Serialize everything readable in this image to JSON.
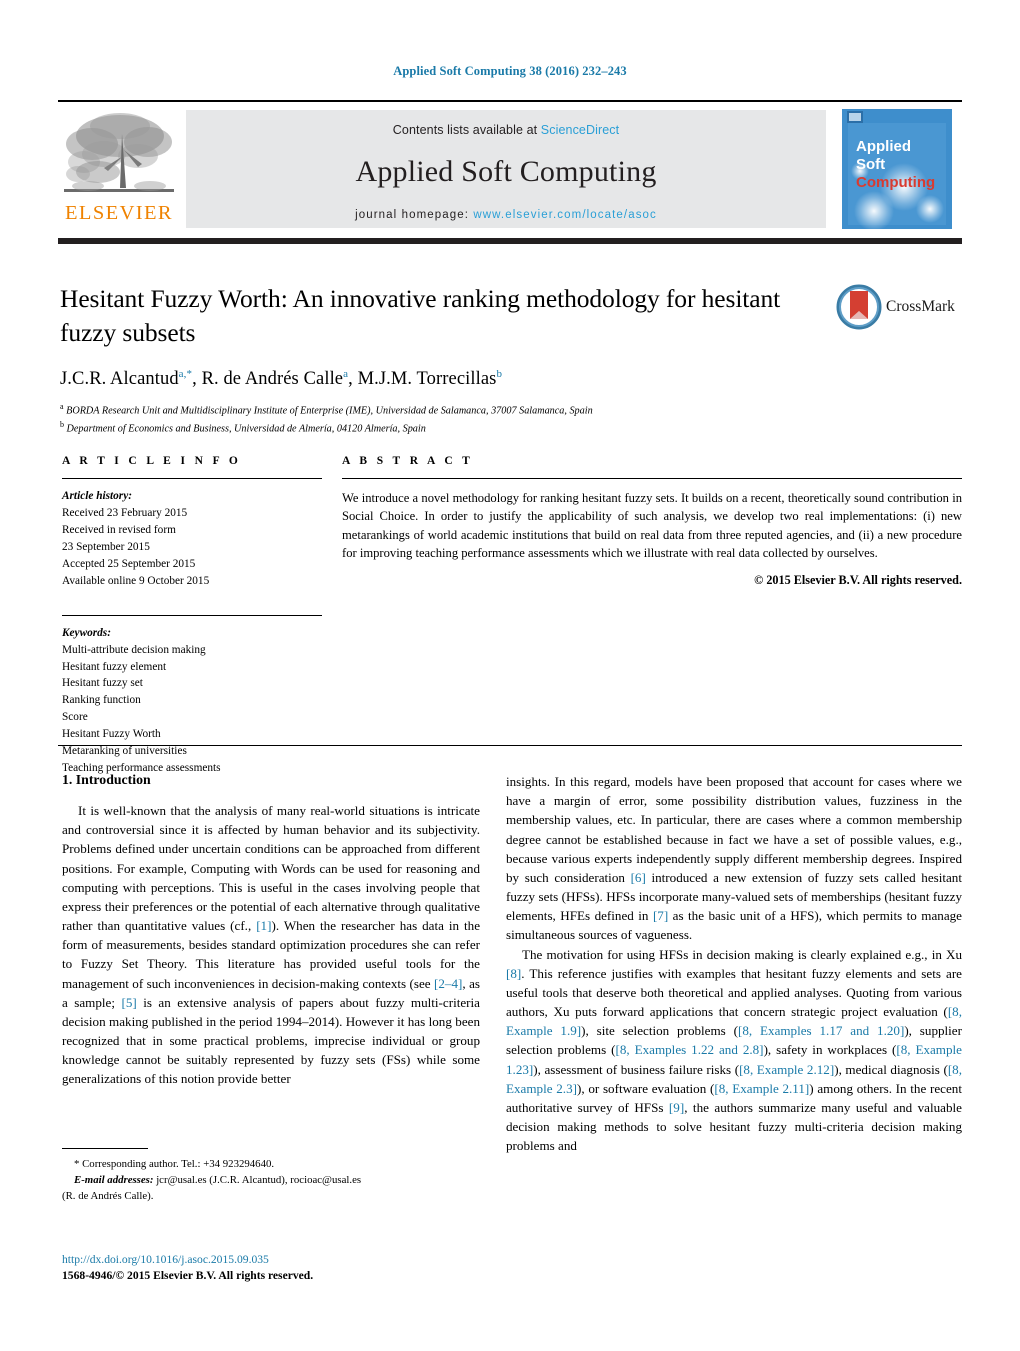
{
  "running_head": "Applied Soft Computing 38 (2016) 232–243",
  "masthead": {
    "contents_prefix": "Contents lists available at ",
    "sciencedirect": "ScienceDirect",
    "journal_title": "Applied Soft Computing",
    "homepage_prefix": "journal homepage: ",
    "homepage_url": "www.elsevier.com/locate/asoc",
    "publisher_wordmark": "ELSEVIER",
    "publisher_wordmark_color": "#ef8200",
    "cover": {
      "line1": "Applied",
      "line2": "Soft",
      "line3": "Computing",
      "bg_color": "#3e8ecc",
      "line3_color": "#d93b30"
    }
  },
  "crossmark": {
    "label": "CrossMark"
  },
  "article": {
    "title": "Hesitant Fuzzy Worth: An innovative ranking methodology for hesitant fuzzy subsets",
    "authors": [
      {
        "name": "J.C.R. Alcantud",
        "sup": "a,*"
      },
      {
        "name": "R. de Andrés Calle",
        "sup": "a"
      },
      {
        "name": "M.J.M. Torrecillas",
        "sup": "b"
      }
    ],
    "affiliations": [
      {
        "marker": "a",
        "text": "BORDA Research Unit and Multidisciplinary Institute of Enterprise (IME), Universidad de Salamanca, 37007 Salamanca, Spain"
      },
      {
        "marker": "b",
        "text": "Department of Economics and Business, Universidad de Almería, 04120 Almería, Spain"
      }
    ]
  },
  "article_info": {
    "heading": "A R T I C L E   I N F O",
    "history_label": "Article history:",
    "history_lines": [
      "Received 23 February 2015",
      "Received in revised form",
      "23 September 2015",
      "Accepted 25 September 2015",
      "Available online 9 October 2015"
    ],
    "keywords_label": "Keywords:",
    "keywords": [
      "Multi-attribute decision making",
      "Hesitant fuzzy element",
      "Hesitant fuzzy set",
      "Ranking function",
      "Score",
      "Hesitant Fuzzy Worth",
      "Metaranking of universities",
      "Teaching performance assessments"
    ]
  },
  "abstract": {
    "heading": "A B S T R A C T",
    "text": "We introduce a novel methodology for ranking hesitant fuzzy sets. It builds on a recent, theoretically sound contribution in Social Choice. In order to justify the applicability of such analysis, we develop two real implementations: (i) new metarankings of world academic institutions that build on real data from three reputed agencies, and (ii) a new procedure for improving teaching performance assessments which we illustrate with real data collected by ourselves.",
    "copyright": "© 2015 Elsevier B.V. All rights reserved."
  },
  "body": {
    "section_number_title": "1.  Introduction",
    "left_paragraph_1_a": "It is well-known that the analysis of many real-world situations is intricate and controversial since it is affected by human behavior and its subjectivity. Problems defined under uncertain conditions can be approached from different positions. For example, Computing with Words can be used for reasoning and computing with perceptions. This is useful in the cases involving people that express their preferences or the potential of each alternative through qualitative rather than quantitative values (cf., ",
    "ref_1": "[1]",
    "left_paragraph_1_b": "). When the researcher has data in the form of measurements, besides standard optimization procedures she can refer to Fuzzy Set Theory. This literature has provided useful tools for the management of such inconveniences in decision-making contexts (see ",
    "ref_2_4": "[2–4]",
    "left_paragraph_1_c": ", as a sample; ",
    "ref_5": "[5]",
    "left_paragraph_1_d": " is an extensive analysis of papers about fuzzy multi-criteria decision making published in the period 1994–2014). However it has long been recognized that in some practical problems, imprecise individual or group knowledge cannot be suitably represented by fuzzy sets (FSs) while some generalizations of this notion provide better",
    "right_paragraph_1_a": "insights. In this regard, models have been proposed that account for cases where we have a margin of error, some possibility distribution values, fuzziness in the membership values, etc. In particular, there are cases where a common membership degree cannot be established because in fact we have a set of possible values, e.g., because various experts independently supply different membership degrees. Inspired by such consideration ",
    "ref_6": "[6]",
    "right_paragraph_1_b": " introduced a new extension of fuzzy sets called hesitant fuzzy sets (HFSs). HFSs incorporate many-valued sets of memberships (hesitant fuzzy elements, HFEs defined in ",
    "ref_7": "[7]",
    "right_paragraph_1_c": " as the basic unit of a HFS), which permits to manage simultaneous sources of vagueness.",
    "right_paragraph_2_a": "The motivation for using HFSs in decision making is clearly explained e.g., in Xu ",
    "ref_8": "[8]",
    "right_paragraph_2_b": ". This reference justifies with examples that hesitant fuzzy elements and sets are useful tools that deserve both theoretical and applied analyses. Quoting from various authors, Xu puts forward applications that concern strategic project evaluation (",
    "ref_8_ex19": "[8, Example 1.9]",
    "right_paragraph_2_c": "), site selection problems (",
    "ref_8_ex117_120": "[8, Examples 1.17 and 1.20]",
    "right_paragraph_2_d": "), supplier selection problems (",
    "ref_8_ex122_28": "[8, Examples 1.22 and 2.8]",
    "right_paragraph_2_e": "), safety in workplaces (",
    "ref_8_ex123": "[8, Example 1.23]",
    "right_paragraph_2_f": "), assessment of business failure risks (",
    "ref_8_ex212": "[8, Example 2.12]",
    "right_paragraph_2_g": "), medical diagnosis (",
    "ref_8_ex23": "[8, Example 2.3]",
    "right_paragraph_2_h": "), or software evaluation (",
    "ref_8_ex211": "[8, Example 2.11]",
    "right_paragraph_2_i": ") among others. In the recent authoritative survey of HFSs ",
    "ref_9": "[9]",
    "right_paragraph_2_j": ", the authors summarize many useful and valuable decision making methods to solve hesitant fuzzy multi-criteria decision making problems and"
  },
  "footnotes": {
    "corresponding": "* Corresponding author. Tel.: +34 923294640.",
    "email_label": "E-mail addresses:",
    "email_1": "jcr@usal.es",
    "email_1_owner": " (J.C.R. Alcantud), ",
    "email_2": "rocioac@usal.es",
    "email_2_owner": "(R. de Andrés Calle)."
  },
  "doi": {
    "url": "http://dx.doi.org/10.1016/j.asoc.2015.09.035",
    "issn_line": "1568-4946/© 2015 Elsevier B.V. All rights reserved."
  },
  "colors": {
    "link": "#1a7aa8",
    "sciencedirect": "#2a9fd6",
    "elsevier_orange": "#ef8200",
    "panel_gray": "#e6e7e8"
  }
}
